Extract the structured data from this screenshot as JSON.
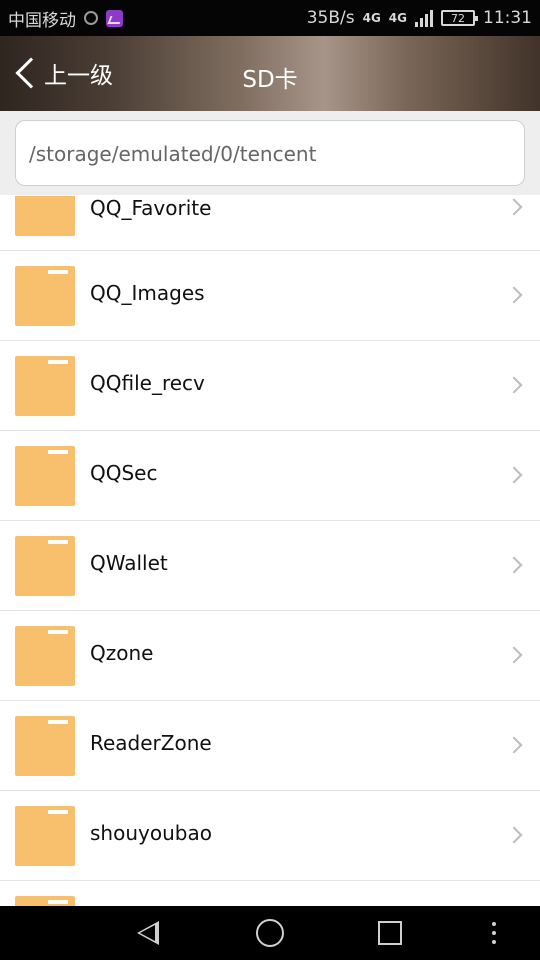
{
  "status_bar": {
    "carrier": "中国移动",
    "net_speed": "35B/s",
    "net_type_1": "4G",
    "net_type_2": "4G",
    "battery": "72",
    "time": "11:31"
  },
  "header": {
    "back_label": "上一级",
    "title": "SD卡"
  },
  "path": {
    "value": "/storage/emulated/0/tencent"
  },
  "folders": [
    {
      "name": "QQ_Favorite"
    },
    {
      "name": "QQ_Images"
    },
    {
      "name": "QQfile_recv"
    },
    {
      "name": "QQSec"
    },
    {
      "name": "QWallet"
    },
    {
      "name": "Qzone"
    },
    {
      "name": "ReaderZone"
    },
    {
      "name": "shouyoubao"
    },
    {
      "name": ""
    }
  ],
  "colors": {
    "folder": "#f8bf6d",
    "status_bar_bg": "#050505",
    "nav_bar_bg": "#000000"
  },
  "icons": {
    "back": "chevron-left-icon",
    "folder": "folder-icon",
    "row_arrow": "chevron-right-icon",
    "nav": [
      "nav-back-icon",
      "nav-home-icon",
      "nav-recent-icon",
      "nav-more-icon"
    ]
  }
}
